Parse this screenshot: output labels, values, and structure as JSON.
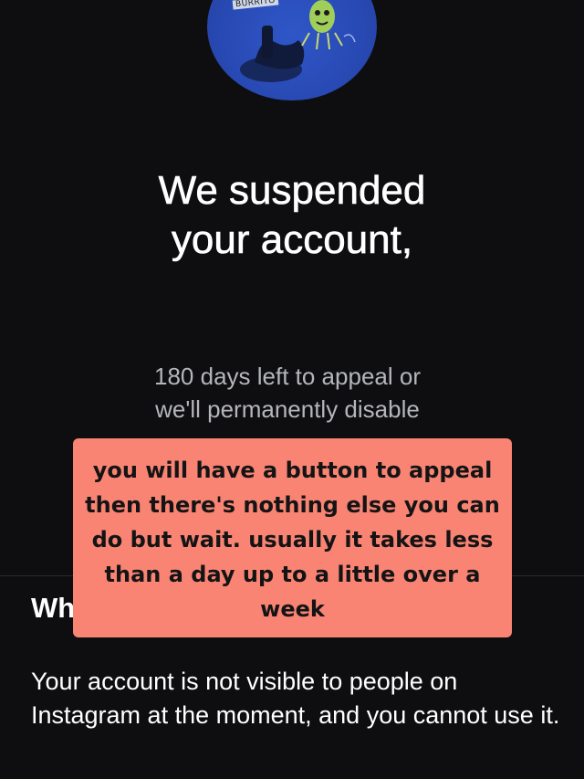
{
  "profile": {
    "avatar_icon": "profile-avatar",
    "avatar_tag": "BURRITO"
  },
  "header": {
    "title_line1": "We suspended",
    "title_line2": "your account,"
  },
  "appeal": {
    "line1": "180 days left to appeal or",
    "line2": "we'll permanently disable"
  },
  "overlay_note": {
    "text": "you will have a button to appeal then there's nothing else you can do but wait. usually it takes less than a day up to a little over a week",
    "background_color": "#f98474"
  },
  "section": {
    "heading_visible": "Wh",
    "body": "Your account is not visible to people on Instagram at the moment, and you cannot use it."
  },
  "colors": {
    "background": "#0e0e10",
    "primary_text": "#ffffff",
    "secondary_text": "#b4b6bb",
    "avatar_blue": "#2849b3"
  }
}
